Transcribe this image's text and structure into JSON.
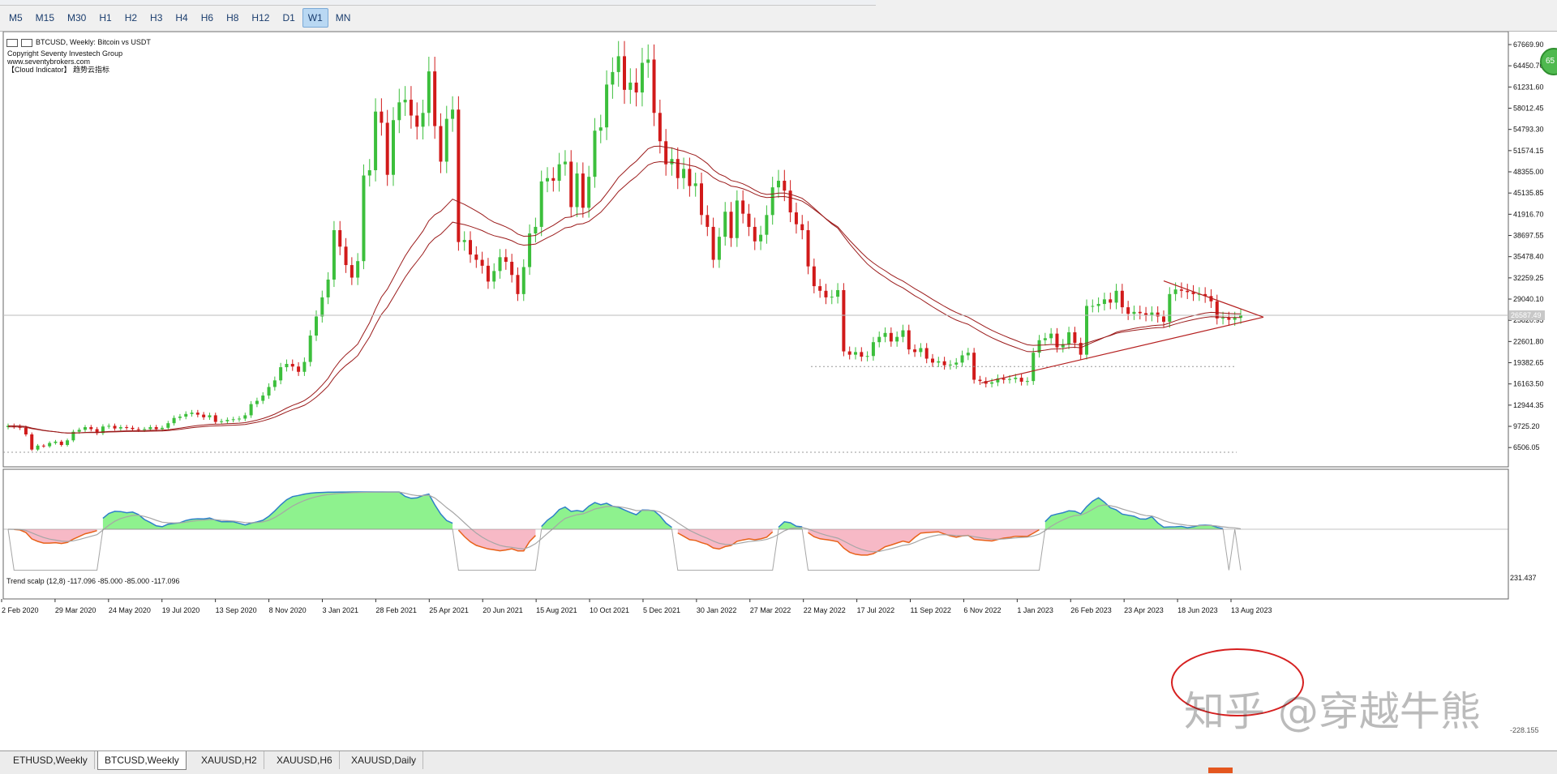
{
  "toolbar": {
    "timeframes": [
      "M5",
      "M15",
      "M30",
      "H1",
      "H2",
      "H3",
      "H4",
      "H6",
      "H8",
      "H12",
      "D1",
      "W1",
      "MN"
    ],
    "active": "W1"
  },
  "chart": {
    "header": {
      "title": "BTCUSD, Weekly:  Bitcoin vs USDT",
      "copyright": "Copyright Seventy Investech Group",
      "website": " www.seventybrokers.com",
      "indicator": "【Cloud Indicator】 趋势云指标"
    },
    "current_price_label": "26587.49",
    "indicator_label": "Trend scalp (12,8) -117.096 -85.000 -85.000 -117.096",
    "indicator_max": "231.437",
    "indicator_min": "-228.155",
    "badge_text": "65",
    "watermark": "知乎 @穿越牛熊",
    "colors": {
      "bull": "#3cbf3c",
      "bear": "#d11a1a",
      "ma": "#9b1b1b",
      "osc_up": "#8ef28e",
      "osc_down": "#f7b9c6",
      "osc_line_up": "#2f7fc9",
      "osc_line_down": "#e8621a",
      "gray": "#a6a6a6"
    }
  },
  "chart_data": {
    "type": "candlestick",
    "title": "BTCUSD, Weekly:  Bitcoin vs USDT",
    "price_ticks": [
      67669.9,
      64450.7,
      61231.6,
      58012.45,
      54793.3,
      51574.15,
      48355.0,
      45135.85,
      41916.7,
      38697.55,
      35478.4,
      32259.25,
      29040.1,
      25820.95,
      22601.8,
      19382.65,
      16163.5,
      12944.35,
      9725.2,
      6506.05
    ],
    "date_ticks": [
      "2 Feb 2020",
      "29 Mar 2020",
      "24 May 2020",
      "19 Jul 2020",
      "13 Sep 2020",
      "8 Nov 2020",
      "3 Jan 2021",
      "28 Feb 2021",
      "25 Apr 2021",
      "20 Jun 2021",
      "15 Aug 2021",
      "10 Oct 2021",
      "5 Dec 2021",
      "30 Jan 2022",
      "27 Mar 2022",
      "22 May 2022",
      "17 Jul 2022",
      "11 Sep 2022",
      "6 Nov 2022",
      "1 Jan 2023",
      "26 Feb 2023",
      "23 Apr 2023",
      "18 Jun 2023",
      "13 Aug 2023"
    ],
    "closes": [
      9800,
      9700,
      9500,
      8500,
      6200,
      6800,
      6700,
      7200,
      7400,
      6900,
      7600,
      8900,
      9200,
      9600,
      9300,
      8700,
      9700,
      9800,
      9400,
      9600,
      9500,
      9300,
      9200,
      9300,
      9600,
      9300,
      9500,
      10200,
      11000,
      11200,
      11600,
      11800,
      11500,
      11100,
      11400,
      10400,
      10500,
      10700,
      10800,
      10900,
      11400,
      13100,
      13600,
      14400,
      15700,
      16700,
      18700,
      19200,
      18800,
      18000,
      19500,
      23500,
      26400,
      29300,
      32000,
      39500,
      37000,
      34200,
      32300,
      34800,
      47800,
      48600,
      57500,
      55800,
      47900,
      56200,
      58900,
      59300,
      56900,
      55200,
      57300,
      63600,
      55300,
      49900,
      56400,
      57800,
      37700,
      38000,
      35800,
      35000,
      34100,
      31700,
      33300,
      35400,
      34700,
      32700,
      29800,
      33900,
      39000,
      40000,
      46900,
      47400,
      47000,
      49500,
      49900,
      43000,
      48100,
      42900,
      47600,
      54600,
      55100,
      61600,
      63500,
      65900,
      60800,
      61900,
      60400,
      64900,
      65400,
      57300,
      53000,
      49500,
      50300,
      47400,
      48800,
      46200,
      46600,
      41800,
      40000,
      35000,
      38500,
      42300,
      38300,
      44000,
      42000,
      40000,
      37800,
      38800,
      41800,
      46000,
      47000,
      45500,
      42200,
      40400,
      39500,
      34000,
      31000,
      30300,
      29300,
      29400,
      30400,
      21100,
      20600,
      21000,
      20300,
      20400,
      22500,
      23300,
      23900,
      22600,
      23300,
      24300,
      21400,
      21000,
      21600,
      20000,
      19400,
      19600,
      19000,
      19100,
      19400,
      20500,
      20900,
      16800,
      16600,
      16200,
      16400,
      17000,
      16800,
      16900,
      17100,
      16500,
      16600,
      20900,
      22800,
      23100,
      23800,
      21700,
      22200,
      24000,
      22400,
      20600,
      28000,
      28000,
      28300,
      29000,
      28500,
      30300,
      27800,
      26800,
      27100,
      26900,
      26600,
      27000,
      26400,
      25600,
      29800,
      30500,
      30300,
      30100,
      29800,
      29800,
      29500,
      28700,
      26100,
      26200,
      25900,
      26200,
      26587
    ]
  }
}
